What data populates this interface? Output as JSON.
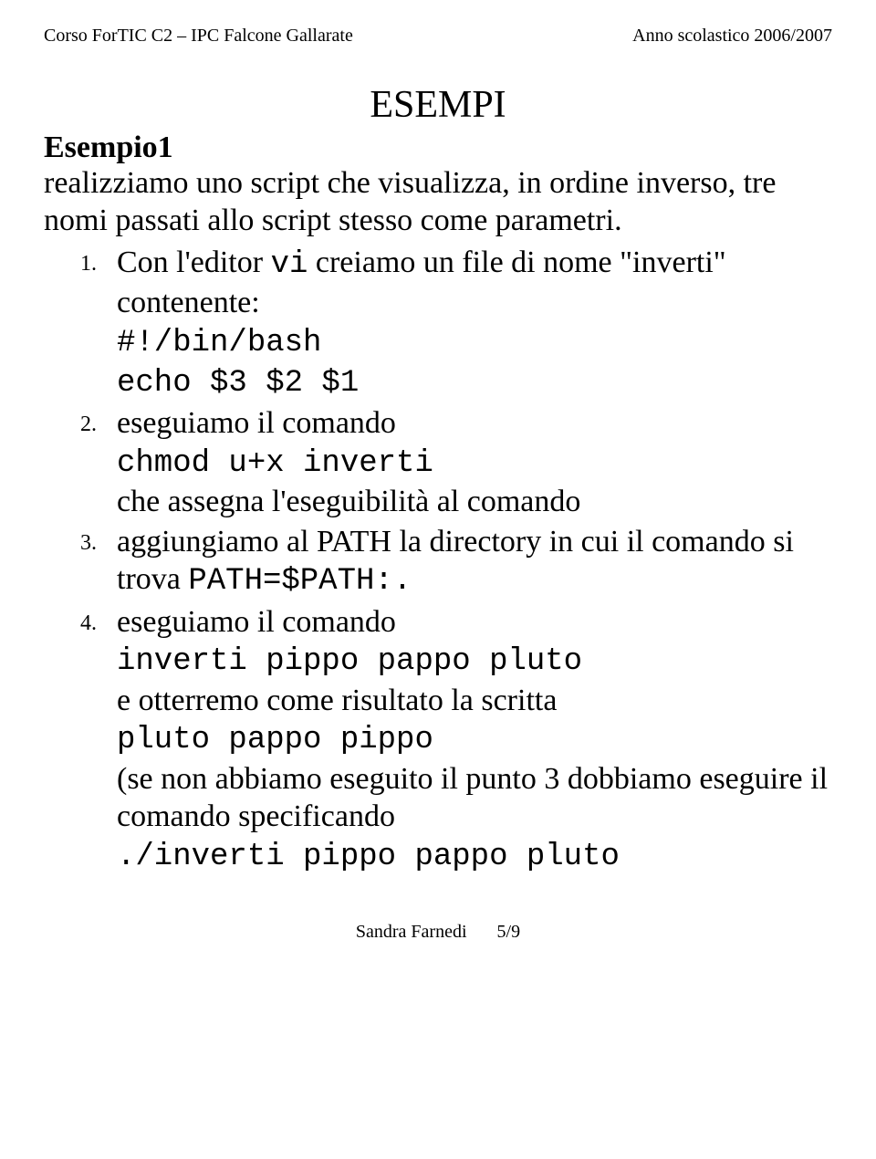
{
  "header": {
    "left": "Corso ForTIC C2 – IPC Falcone Gallarate",
    "right": "Anno scolastico 2006/2007"
  },
  "title": "ESEMPI",
  "heading": "Esempio1",
  "intro": "realizziamo uno script che visualizza, in ordine inverso, tre nomi passati allo script stesso come parametri.",
  "items": {
    "n1": "1.",
    "n2": "2.",
    "n3": "3.",
    "n4": "4.",
    "i1a": "Con l'editor ",
    "i1vi": "vi",
    "i1b": "  creiamo un file di nome \"inverti\" contenente:",
    "i1code1": "#!/bin/bash",
    "i1code2": "echo $3 $2 $1",
    "i2a": "eseguiamo il comando",
    "i2code": "chmod u+x inverti",
    "i2b": "che assegna l'eseguibilità al comando",
    "i3a": "aggiungiamo al PATH la directory in cui il comando si trova ",
    "i3code": "PATH=$PATH:.",
    "i4a": "eseguiamo il comando",
    "i4code1": "inverti pippo pappo pluto",
    "i4b": "e otterremo come risultato la scritta",
    "i4code2": "pluto pappo pippo",
    "i4c": "(se non abbiamo eseguito il punto 3 dobbiamo eseguire il comando specificando",
    "i4code3": "./inverti pippo pappo pluto"
  },
  "footer": {
    "author": "Sandra Farnedi",
    "page": "5/9"
  }
}
